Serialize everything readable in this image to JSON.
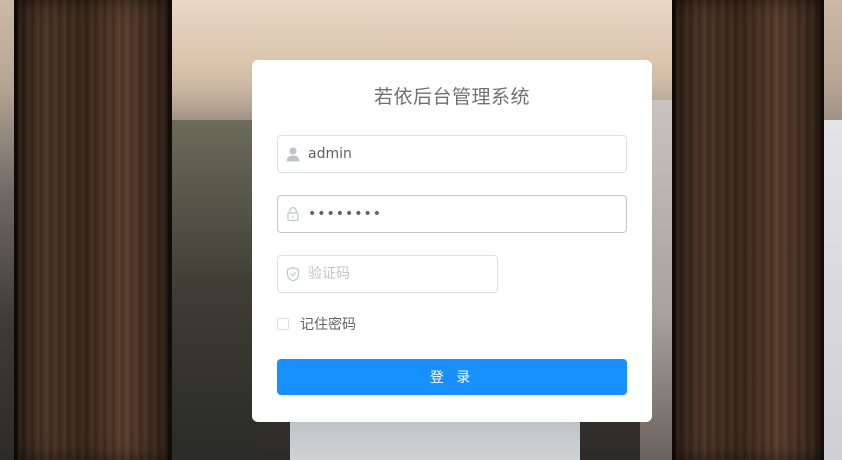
{
  "login": {
    "title": "若依后台管理系统",
    "username_value": "admin",
    "password_value": "admin123",
    "captcha_placeholder": "验证码",
    "remember_label": "记住密码",
    "remember_checked": false,
    "submit_label": "登 录"
  },
  "icons": {
    "username": "user-icon",
    "password": "lock-icon",
    "captcha": "shield-icon"
  },
  "colors": {
    "accent": "#1890ff",
    "input_border": "#dcdfe6",
    "title_text": "#707070",
    "icon": "#c0c4cc"
  }
}
